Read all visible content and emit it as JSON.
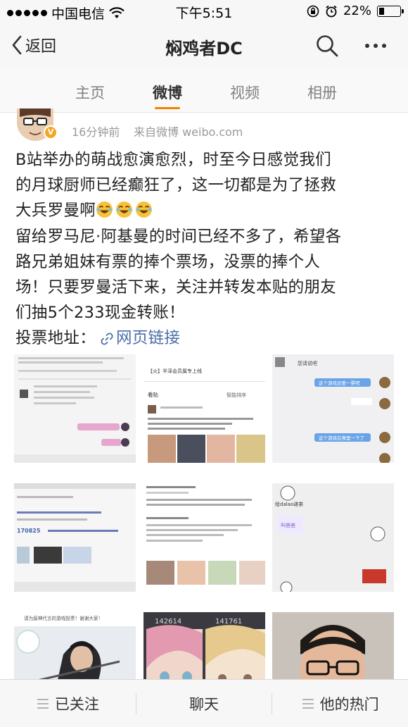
{
  "status_bar": {
    "carrier": "中国电信",
    "time": "下午5:51",
    "battery": "22%"
  },
  "nav": {
    "back_label": "返回",
    "title": "焖鸡者DC"
  },
  "tabs": [
    {
      "label": "主页",
      "active": false
    },
    {
      "label": "微博",
      "active": true
    },
    {
      "label": "视频",
      "active": false
    },
    {
      "label": "相册",
      "active": false
    }
  ],
  "post": {
    "time": "16分钟前",
    "source": "来自微博 weibo.com",
    "lines": [
      "B站举办的萌战愈演愈烈，时至今日感觉我们",
      "的月球厨师已经癫狂了，这一切都是为了拯救",
      "大兵罗曼啊",
      "留给罗马尼·阿基曼的时间已经不多了，希望各",
      "路兄弟姐妹有票的捧个票场，没票的捧个人",
      "场！只要罗曼活下来，关注并转发本贴的朋友",
      "们抽5个233现金转账！"
    ],
    "vote_label": "投票地址：",
    "link_label": "网页链接"
  },
  "images": {
    "thumb2_title": "【火】半泽会员属专上线",
    "thumb2_tab": "看贴",
    "thumb2_sort": "智能排序",
    "thumb3_title": "您请说吧",
    "thumb3_bubble1": "这个游戏还要一票吧",
    "thumb3_bubble2": "这个游戏在哪里一下了",
    "thumb4_num": "170825",
    "thumb6_label": "给dalao递茶",
    "thumb6_sticker": "叫爸爸",
    "thumb7_caption": "请为腐神代言的游戏投票！谢谢大家！",
    "thumb8_num_left": "142614",
    "thumb8_num_right": "141761"
  },
  "bottom_bar": {
    "follow_label": "已关注",
    "chat_label": "聊天",
    "hot_label": "他的热门"
  },
  "colors": {
    "accent": "#f08300",
    "link": "#4a6ea8",
    "meta_text": "#9a9a9a"
  }
}
